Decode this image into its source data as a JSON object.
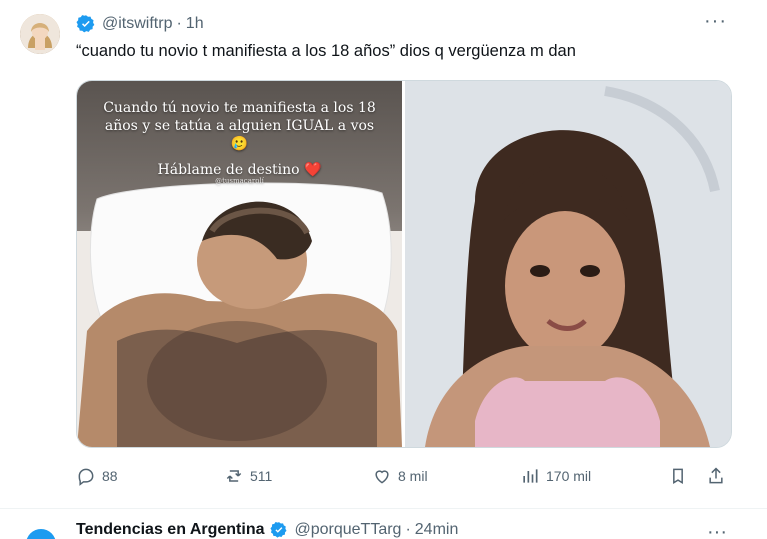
{
  "tweet": {
    "handle": "@itswiftrp",
    "separator": "·",
    "time": "1h",
    "more": "···",
    "text": "“cuando tu novio t manifiesta a los 18 años” dios q vergüenza m dan",
    "media": {
      "left_caption_1": "Cuando tú novio te manifiesta a los 18 años y se tatúa a alguien IGUAL a vos 🥲",
      "left_caption_2": "Háblame de destino ❤️",
      "left_watermark": "@tusmacarolí"
    },
    "actions": {
      "replies": "88",
      "retweets": "511",
      "likes": "8 mil",
      "views": "170 mil"
    }
  },
  "next_tweet": {
    "title": "Tendencias en Argentina",
    "handle": "@porqueTTarg",
    "separator": "·",
    "time": "24min",
    "more": "···"
  },
  "colors": {
    "verified": "#1d9bf0",
    "muted": "#536471",
    "text": "#0f1419"
  }
}
